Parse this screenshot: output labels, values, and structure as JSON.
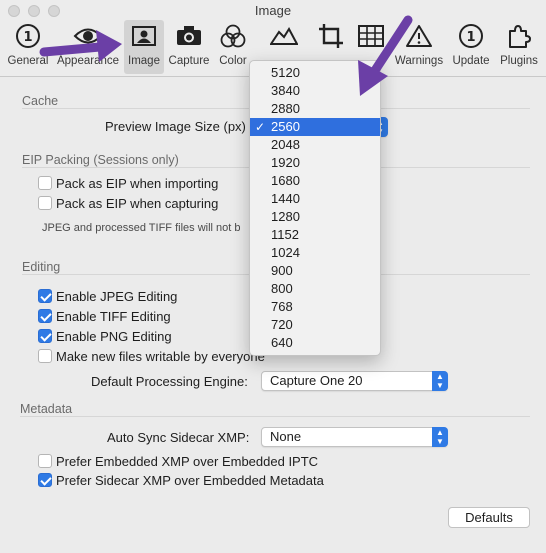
{
  "window": {
    "title": "Image"
  },
  "toolbar": {
    "tabs": [
      {
        "label": "General",
        "icon": "info-circle-icon"
      },
      {
        "label": "Appearance",
        "icon": "eye-icon"
      },
      {
        "label": "Image",
        "icon": "image-icon",
        "active": true
      },
      {
        "label": "Capture",
        "icon": "camera-icon"
      },
      {
        "label": "Color",
        "icon": "color-circles-icon"
      },
      {
        "label": "",
        "icon": "mountain-icon"
      },
      {
        "label": "",
        "icon": "crop-icon"
      },
      {
        "label": "",
        "icon": "grid-icon"
      },
      {
        "label": "Warnings",
        "icon": "warning-icon"
      },
      {
        "label": "Update",
        "icon": "update-icon"
      },
      {
        "label": "Plugins",
        "icon": "puzzle-icon"
      }
    ]
  },
  "cache": {
    "title": "Cache",
    "preview_label": "Preview Image Size (px)"
  },
  "eip": {
    "title": "EIP Packing (Sessions only)",
    "pack_importing": {
      "label": "Pack as EIP when importing",
      "checked": false
    },
    "pack_capturing": {
      "label": "Pack as EIP when capturing",
      "checked": false
    },
    "note": "JPEG and processed TIFF files will not b"
  },
  "editing": {
    "title": "Editing",
    "jpeg": {
      "label": "Enable JPEG Editing",
      "checked": true
    },
    "tiff": {
      "label": "Enable TIFF Editing",
      "checked": true
    },
    "png": {
      "label": "Enable PNG Editing",
      "checked": true
    },
    "writable": {
      "label": "Make new files writable by everyone",
      "checked": false
    },
    "engine_label": "Default Processing Engine:",
    "engine_value": "Capture One 20"
  },
  "metadata": {
    "title": "Metadata",
    "sync_label": "Auto Sync Sidecar XMP:",
    "sync_value": "None",
    "prefer_xmp_iptc": {
      "label": "Prefer Embedded XMP over Embedded IPTC",
      "checked": false
    },
    "prefer_sidecar": {
      "label": "Prefer Sidecar XMP over Embedded Metadata",
      "checked": true
    }
  },
  "defaults_button": "Defaults",
  "preview_menu": {
    "options": [
      "5120",
      "3840",
      "2880",
      "2560",
      "2048",
      "1920",
      "1680",
      "1440",
      "1280",
      "1152",
      "1024",
      "900",
      "800",
      "768",
      "720",
      "640"
    ],
    "selected": "2560",
    "check_glyph": "✓"
  },
  "colors": {
    "accent": "#2f7ae5",
    "selection": "#2f6fde",
    "annotation_arrow": "#6b3fa6"
  }
}
